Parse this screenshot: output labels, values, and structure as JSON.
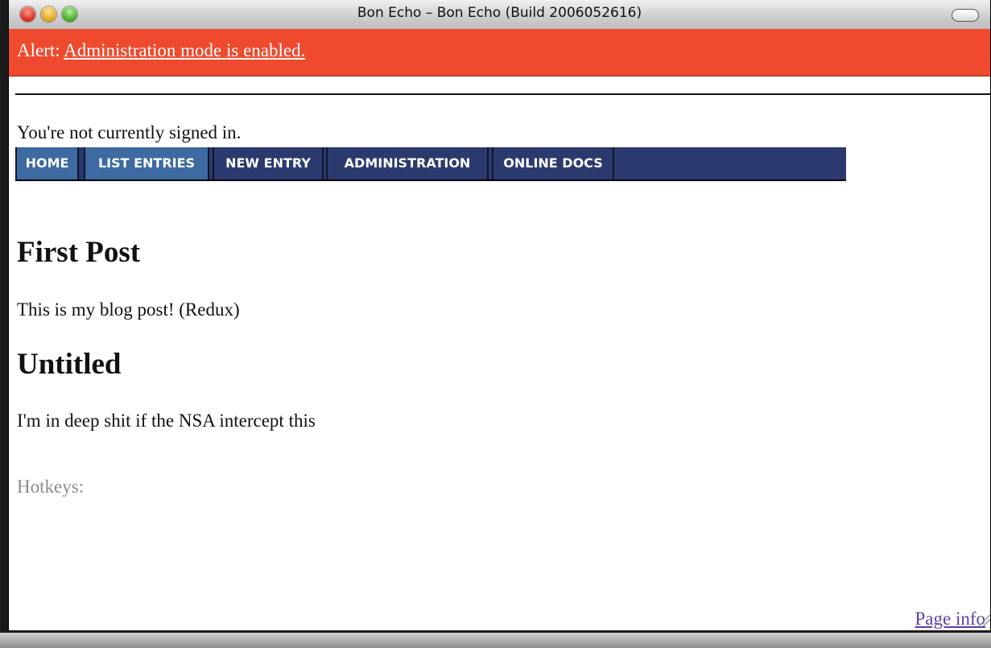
{
  "window": {
    "title": "Bon Echo – Bon Echo (Build 2006052616)"
  },
  "alert": {
    "prefix": "Alert:",
    "link_text": "Administration mode is enabled.",
    "color": "#ef4a2e"
  },
  "status": {
    "signin_text": "You're not currently signed in."
  },
  "nav": {
    "tabs": [
      {
        "label": "HOME",
        "style": "light"
      },
      {
        "label": "LIST ENTRIES",
        "style": "light"
      },
      {
        "label": "NEW ENTRY",
        "style": "dark"
      },
      {
        "label": "ADMINISTRATION",
        "style": "dark"
      },
      {
        "label": "ONLINE DOCS",
        "style": "dark"
      }
    ]
  },
  "posts": [
    {
      "title": "First Post",
      "body": "This is my blog post! (Redux)"
    },
    {
      "title": "Untitled",
      "body": "I'm in deep shit if the NSA intercept this"
    }
  ],
  "footer": {
    "hotkeys_label": "Hotkeys:",
    "page_info_link": "Page info"
  }
}
